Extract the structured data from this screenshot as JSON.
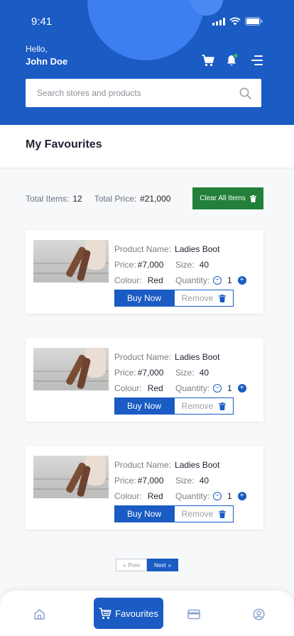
{
  "status_bar": {
    "time": "9:41"
  },
  "header": {
    "greeting": "Hello,",
    "user_name": "John Doe",
    "search_placeholder": "Search stores and products"
  },
  "page": {
    "title": "My Favourites"
  },
  "summary": {
    "total_items_label": "Total Items:",
    "total_items_value": "12",
    "total_price_label": "Total Price:",
    "total_price_value": "#21,000",
    "clear_label": "Clear All Items"
  },
  "labels": {
    "product_name": "Product Name:",
    "price": "Price:",
    "size": "Size:",
    "colour": "Colour:",
    "quantity": "Quantity:",
    "buy_now": "Buy Now",
    "remove": "Remove"
  },
  "items": [
    {
      "name": "Ladies Boot",
      "price": "#7,000",
      "size": "40",
      "colour": "Red",
      "quantity": "1"
    },
    {
      "name": "Ladies Boot",
      "price": "#7,000",
      "size": "40",
      "colour": "Red",
      "quantity": "1"
    },
    {
      "name": "Ladies Boot",
      "price": "#7,000",
      "size": "40",
      "colour": "Red",
      "quantity": "1"
    }
  ],
  "pagination": {
    "prev_label": "Prev",
    "next_label": "Next"
  },
  "bottom_nav": {
    "items": [
      {
        "icon": "home-icon"
      },
      {
        "icon": "cart-icon",
        "label": "Favourites",
        "active": true
      },
      {
        "icon": "card-icon"
      },
      {
        "icon": "profile-icon"
      }
    ]
  },
  "colors": {
    "primary": "#1a5bc4",
    "success": "#23803a",
    "notification": "#2fc25b"
  }
}
